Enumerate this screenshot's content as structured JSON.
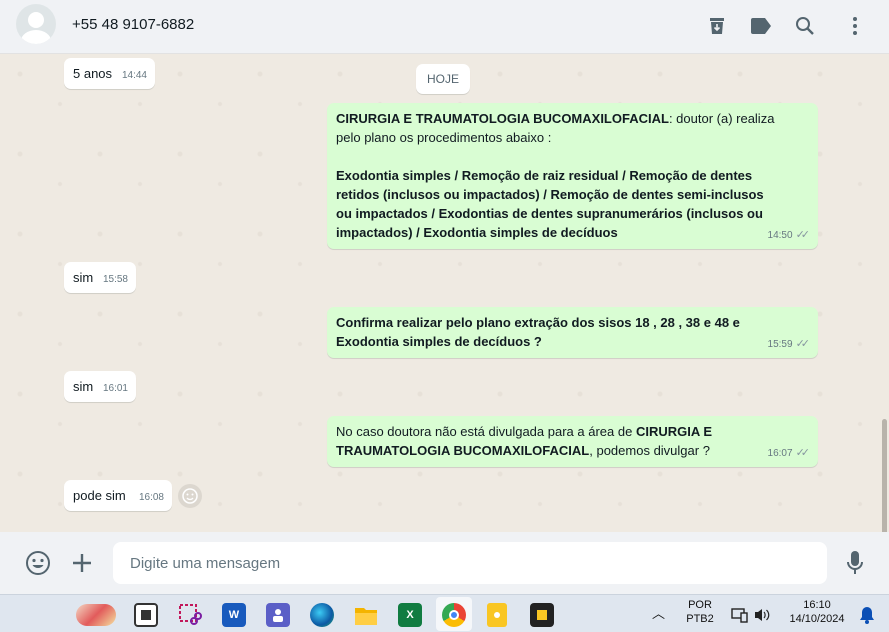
{
  "header": {
    "contact_name": "+55 48 9107-6882",
    "icons": [
      "archive-icon",
      "label-icon",
      "search-icon",
      "menu-icon"
    ]
  },
  "chat": {
    "date_chip": "HOJE",
    "messages": [
      {
        "direction": "in",
        "text": "5 anos",
        "time": "14:44"
      },
      {
        "direction": "out",
        "bold_prefix": "CIRURGIA E TRAUMATOLOGIA BUCOMAXILOFACIAL",
        "line1_rest": ":  doutor (a) realiza",
        "line2": "pelo plano os procedimentos abaixo :",
        "bold_line3": "Exodontia simples / Remoção de raiz residual  /  Remoção de dentes",
        "bold_line4": "retidos (inclusos ou impactados) /  Remoção de dentes semi-inclusos",
        "bold_line5": "ou  impactados /  Exodontias de dentes supranumerários (inclusos ou",
        "bold_line6": "impactados) /  Exodontia simples de decíduos",
        "time": "14:50"
      },
      {
        "direction": "in",
        "text": "sim",
        "time": "15:58"
      },
      {
        "direction": "out",
        "bold_line1": "Confirma realizar pelo plano  extração dos sisos 18 , 28 , 38 e 48 e",
        "bold_line2": "Exodontia simples de decíduos ?",
        "time": "15:59"
      },
      {
        "direction": "in",
        "text": "sim",
        "time": "16:01"
      },
      {
        "direction": "out",
        "line1_pre": "No caso doutora não está divulgada para a área de ",
        "line1_bold": "CIRURGIA E",
        "line2_bold": "TRAUMATOLOGIA BUCOMAXILOFACIAL",
        "line2_rest": ", podemos divulgar ?",
        "time": "16:07"
      },
      {
        "direction": "in",
        "text": "pode sim",
        "time": "16:08"
      }
    ]
  },
  "composer": {
    "placeholder": "Digite uma mensagem",
    "icons": [
      "emoji-icon",
      "attach-plus-icon",
      "microphone-icon"
    ]
  },
  "taskbar": {
    "apps": [
      "widgets-icon",
      "task-view-icon",
      "snipping-tool-icon",
      "word-icon",
      "teams-icon",
      "edge-icon",
      "file-explorer-icon",
      "excel-icon",
      "chrome-icon",
      "notes-icon",
      "sticky-icon"
    ],
    "app_letters": {
      "word": "W",
      "excel": "X"
    },
    "language_top": "POR",
    "language_bottom": "PTB2",
    "time": "16:10",
    "date": "14/10/2024"
  },
  "colors": {
    "outgoing_bubble": "#d9fdd3",
    "incoming_bubble": "#ffffff",
    "chat_bg": "#efeae2",
    "header_bg": "#f0f2f5"
  }
}
